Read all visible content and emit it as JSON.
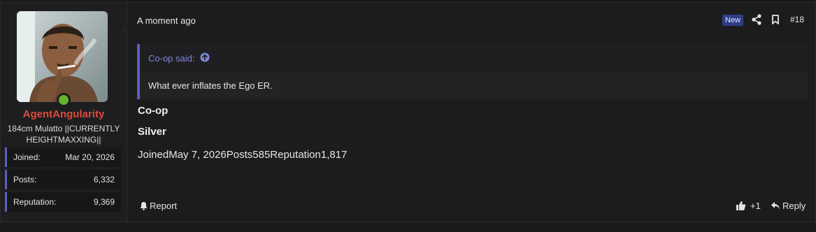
{
  "user": {
    "name": "AgentAngularity",
    "title": "184cm Mulatto ||CURRENTLY HEIGHTMAXXING||",
    "online": true,
    "stats": [
      {
        "label": "Joined:",
        "value": "Mar 20, 2026"
      },
      {
        "label": "Posts:",
        "value": "6,332"
      },
      {
        "label": "Reputation:",
        "value": "9,369"
      }
    ]
  },
  "post": {
    "time": "A moment ago",
    "new_badge": "New",
    "number": "#18",
    "quote": {
      "author": "Co-op said:",
      "text": "What ever inflates the Ego ER."
    },
    "line1": "Co-op",
    "line2": "Silver",
    "info": "JoinedMay 7, 2026Posts585Reputation1,817"
  },
  "actions": {
    "report": "Report",
    "like_count": "+1",
    "reply": "Reply"
  },
  "colors": {
    "username": "#e04b3a",
    "accent": "#5a5fc6",
    "quote_author": "#7f87d6",
    "new_badge_bg": "#2f3d86",
    "online": "#65b32e"
  }
}
